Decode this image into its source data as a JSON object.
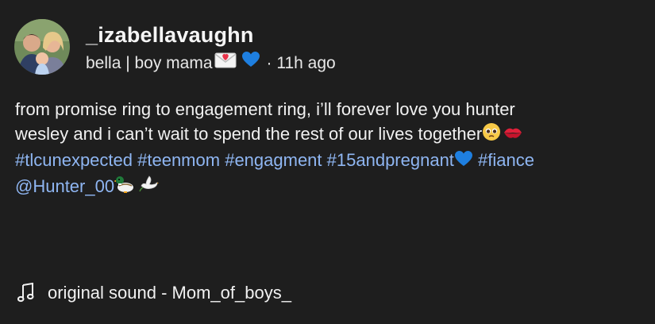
{
  "post": {
    "username": "_izabellavaughn",
    "display_name": "bella | boy mama",
    "time_ago": "· 11h ago",
    "display_name_icons": [
      "love-letter-icon",
      "blue-heart-icon"
    ]
  },
  "caption": {
    "text_line_1": "from promise ring to engagement ring, i’ll forever love you hunter",
    "text_line_2": "wesley and i can’t wait to spend the rest of our lives together",
    "text_line_2_icons": [
      "pleading-face-icon",
      "kiss-mark-icon"
    ],
    "hashtags": [
      "#tlcunexpected",
      "#teenmom",
      "#engagment",
      "#15andpregnant"
    ],
    "hashtag_icon": "blue-heart-icon",
    "hashtag_last": "#fiance",
    "mention": "@Hunter_00",
    "mention_icons": [
      "duck-icon",
      "dove-icon"
    ]
  },
  "sound": {
    "label": "original sound - Mom_of_boys_",
    "icon": "music-note-icon"
  },
  "colors": {
    "background": "#1e1e1e",
    "text": "#f1f1f1",
    "link": "#8fb6f2",
    "blue_heart": "#1e7fe0"
  }
}
